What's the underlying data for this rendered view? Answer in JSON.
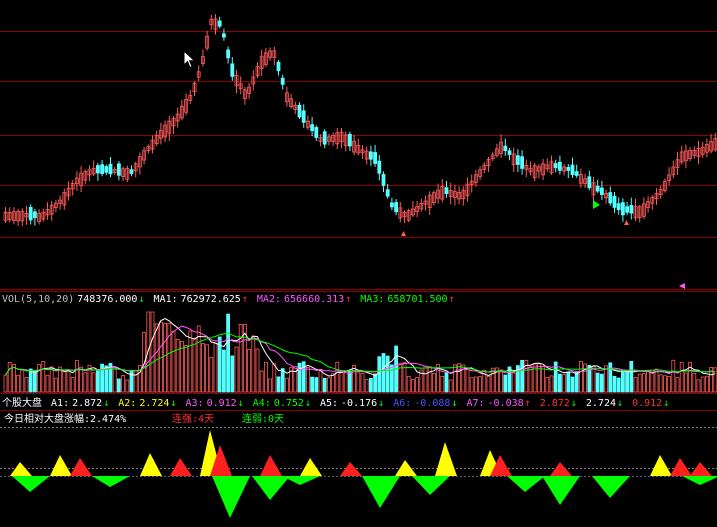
{
  "colors": {
    "up": "#ff5a5a",
    "down": "#54ffff",
    "grid": "#8b0000",
    "white": "#ffffff",
    "yellow": "#ffff00",
    "magenta": "#ff55ff",
    "green": "#00ff00",
    "red": "#ff2020",
    "blue": "#5050ff",
    "gray": "#c0c0c0"
  },
  "volume_header": {
    "label": "VOL(5,10,20)",
    "vol_value": "748376.000",
    "vol_arrow": "↓",
    "ma1_label": "MA1:",
    "ma1_value": "762972.625",
    "ma1_arrow": "↑",
    "ma2_label": "MA2:",
    "ma2_value": "656660.313",
    "ma2_arrow": "↑",
    "ma3_label": "MA3:",
    "ma3_value": "658701.500",
    "ma3_arrow": "↑"
  },
  "indicator_header": {
    "name": "个股大盘",
    "a1_label": "A1:",
    "a1_value": "2.872",
    "a1_arrow": "↓",
    "a2_label": "A2:",
    "a2_value": "2.724",
    "a2_arrow": "↓",
    "a3_label": "A3:",
    "a3_value": "0.912",
    "a3_arrow": "↓",
    "a4_label": "A4:",
    "a4_value": "0.752",
    "a4_arrow": "↓",
    "a5_label": "A5:",
    "a5_value": "-0.176",
    "a5_arrow": "↓",
    "a6_label": "A6:",
    "a6_value": "-0.088",
    "a6_arrow": "↓",
    "a7_label": "A7:",
    "a7_value": "-0.038",
    "a7_arrow": "↑",
    "extra1": "2.872",
    "extra1_arrow": "↓",
    "extra2": "2.724",
    "extra2_arrow": "↓",
    "extra3": "0.912",
    "extra3_arrow": "↓"
  },
  "status_row": {
    "relative_label": "今日相对大盘涨幅:2.474%",
    "strong_label": "连强:4天",
    "weak_label": "连弱:0天"
  },
  "icons": {
    "cursor": "mouse-pointer-icon",
    "marker_low": "arrow-up-marker-icon",
    "marker_buy": "buy-signal-icon"
  }
}
